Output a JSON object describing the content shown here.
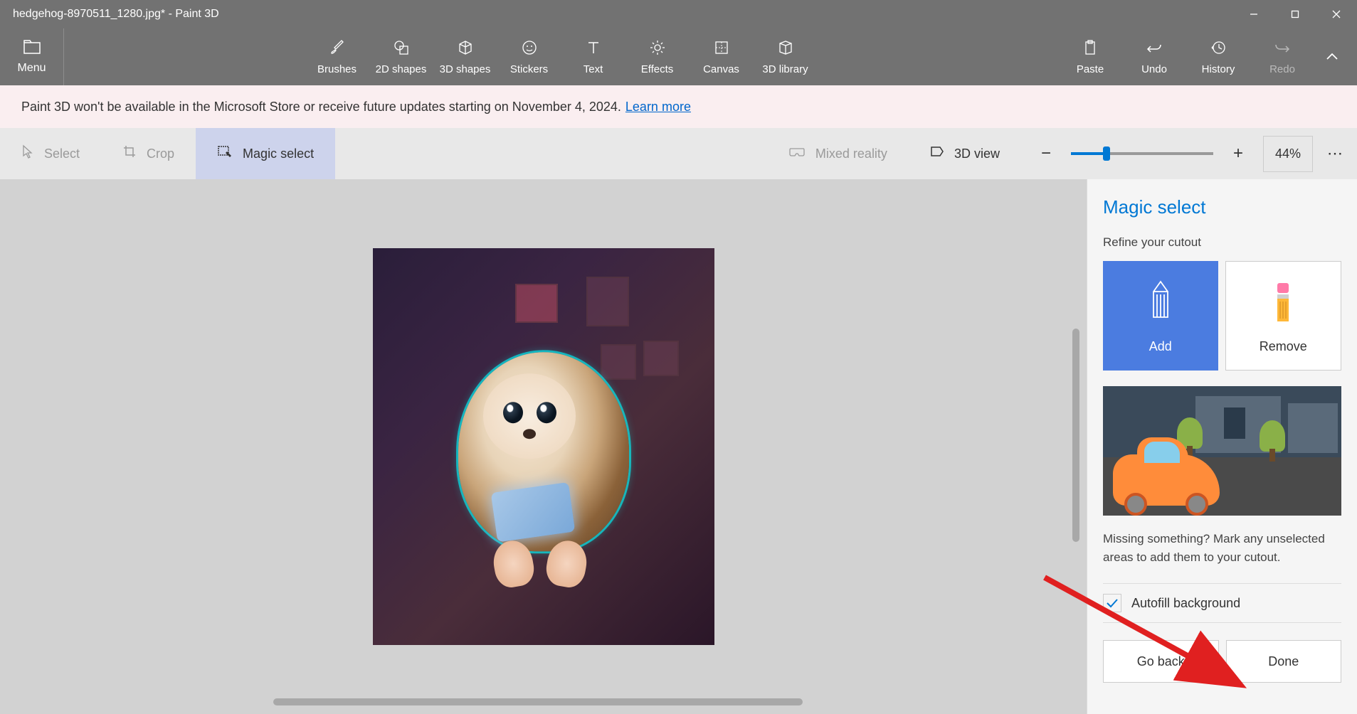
{
  "title_bar": {
    "title": "hedgehog-8970511_1280.jpg* - Paint 3D"
  },
  "toolbar": {
    "menu": "Menu",
    "brushes": "Brushes",
    "shapes2d": "2D shapes",
    "shapes3d": "3D shapes",
    "stickers": "Stickers",
    "text": "Text",
    "effects": "Effects",
    "canvas": "Canvas",
    "library3d": "3D library",
    "paste": "Paste",
    "undo": "Undo",
    "history": "History",
    "redo": "Redo"
  },
  "banner": {
    "text": "Paint 3D won't be available in the Microsoft Store or receive future updates starting on November 4, 2024.",
    "link": "Learn more"
  },
  "secondary": {
    "select": "Select",
    "crop": "Crop",
    "magic_select": "Magic select",
    "mixed_reality": "Mixed reality",
    "view3d": "3D view",
    "zoom_pct": "44%"
  },
  "panel": {
    "title": "Magic select",
    "subtitle": "Refine your cutout",
    "add": "Add",
    "remove": "Remove",
    "help": "Missing something? Mark any unselected areas to add them to your cutout.",
    "autofill": "Autofill background",
    "go_back": "Go back",
    "done": "Done"
  }
}
